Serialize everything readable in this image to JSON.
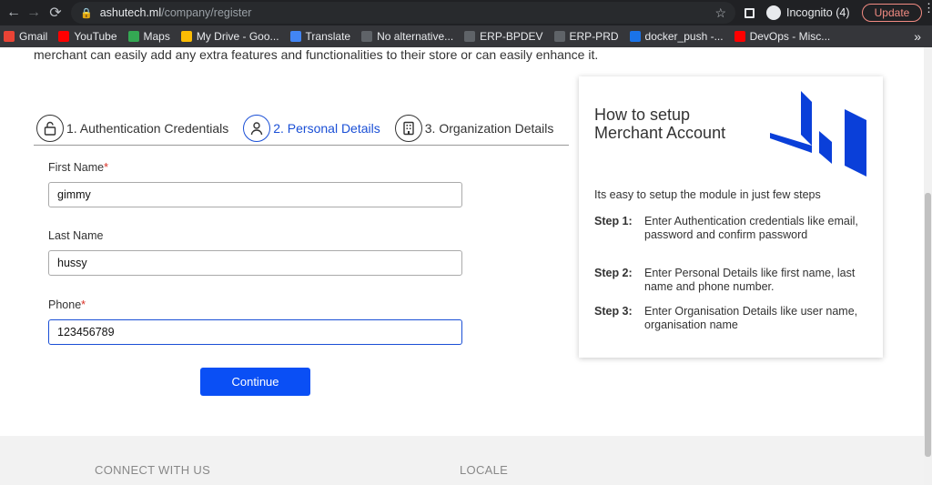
{
  "browser": {
    "url_host": "ashutech.ml",
    "url_path": "/company/register",
    "incognito_label": "Incognito (4)",
    "update_label": "Update",
    "bookmarks": [
      {
        "label": "Gmail",
        "color": "#ea4335"
      },
      {
        "label": "YouTube",
        "color": "#ff0000"
      },
      {
        "label": "Maps",
        "color": "#34a853"
      },
      {
        "label": "My Drive - Goo...",
        "color": "#fbbc04"
      },
      {
        "label": "Translate",
        "color": "#4285f4"
      },
      {
        "label": "No alternative...",
        "color": "#5f6368"
      },
      {
        "label": "ERP-BPDEV",
        "color": "#5f6368"
      },
      {
        "label": "ERP-PRD",
        "color": "#5f6368"
      },
      {
        "label": "docker_push -...",
        "color": "#1a73e8"
      },
      {
        "label": "DevOps - Misc...",
        "color": "#ff0000"
      }
    ],
    "more_bookmarks": "»"
  },
  "page": {
    "intro_text": "merchant can easily add any extra features and functionalities to their store or can easily enhance it.",
    "steps": [
      {
        "label": "1. Authentication Credentials",
        "icon": "lock-icon",
        "active": false
      },
      {
        "label": "2. Personal Details",
        "icon": "user-icon",
        "active": true
      },
      {
        "label": "3. Organization Details",
        "icon": "building-icon",
        "active": false
      }
    ],
    "form": {
      "first_name_label": "First Name",
      "first_name_value": "gimmy",
      "last_name_label": "Last Name",
      "last_name_value": "hussy",
      "phone_label": "Phone",
      "phone_value": "123456789",
      "required_mark": "*",
      "continue_label": "Continue"
    },
    "card": {
      "title_line1": "How to setup",
      "title_line2": "Merchant Account",
      "lead": "Its easy to setup the module in just few steps",
      "steps": [
        {
          "key": "Step 1:",
          "text": "Enter Authentication credentials like email, password and confirm password"
        },
        {
          "key": "Step 2:",
          "text": "Enter Personal Details like first name, last name and phone number."
        },
        {
          "key": "Step 3:",
          "text": "Enter Organisation Details like user name, organisation name"
        }
      ],
      "logo_color": "#0a3fd9"
    },
    "footer": {
      "connect_label": "CONNECT WITH US",
      "locale_label": "LOCALE"
    }
  },
  "colors": {
    "accent": "#0a4ff5",
    "required": "#d93025",
    "active_step": "#1a4fd6"
  }
}
